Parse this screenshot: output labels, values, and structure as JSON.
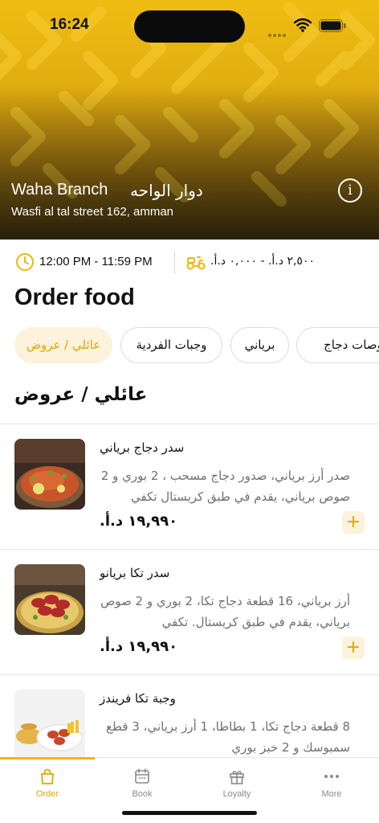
{
  "status_bar": {
    "time": "16:24"
  },
  "branch": {
    "name": "Waha Branch",
    "name_ar": "دوار الواحه",
    "address": "Wasfi al tal street 162, amman"
  },
  "info": {
    "hours": "12:00 PM - 11:59 PM",
    "delivery_fee": "٢,٥٠٠ د.أ. - ٠,٠٠٠ د.أ."
  },
  "page_title": "Order food",
  "categories": [
    {
      "label": "عائلي / عروض",
      "active": true
    },
    {
      "label": "وجبات الفردية",
      "active": false
    },
    {
      "label": "برياني",
      "active": false
    },
    {
      "label": "مخصوصات دجاج",
      "active": false
    }
  ],
  "section_title": "عائلي / عروض",
  "items": [
    {
      "name": "سدر دجاج برياني",
      "description": "صدر أرز برياني، صدور دجاج مسحب ، 2 بوري و 2 صوص برياني، يقدم في طبق كريستال تكفي",
      "price": "١٩,٩٩٠ د.أ.",
      "add_label": "+"
    },
    {
      "name": "سدر تكا بريانو",
      "description": "أرز برياني، 16 قطعة دجاج تكا، 2 بوري و 2 صوص برياني، يقدم في طبق كريستال. تكفي",
      "price": "١٩,٩٩٠ د.أ.",
      "add_label": "+"
    },
    {
      "name": "وجبة تكا فريندز",
      "description": "8 قطعة دجاج تكا، 1 بطاطا، 1 أرز برياني، 3 قطع سمبوسك و 2 خبز بوري",
      "price": "",
      "add_label": "+"
    }
  ],
  "tabs": [
    {
      "label": "Order",
      "icon": "bag-icon",
      "active": true
    },
    {
      "label": "Book",
      "icon": "calendar-icon",
      "active": false
    },
    {
      "label": "Loyalty",
      "icon": "gift-icon",
      "active": false
    },
    {
      "label": "More",
      "icon": "more-dots-icon",
      "active": false
    }
  ],
  "colors": {
    "accent": "#efb60d",
    "accent_text": "#e2a600",
    "accent_soft": "#fdf2db",
    "muted_text": "#6f6f6f"
  }
}
